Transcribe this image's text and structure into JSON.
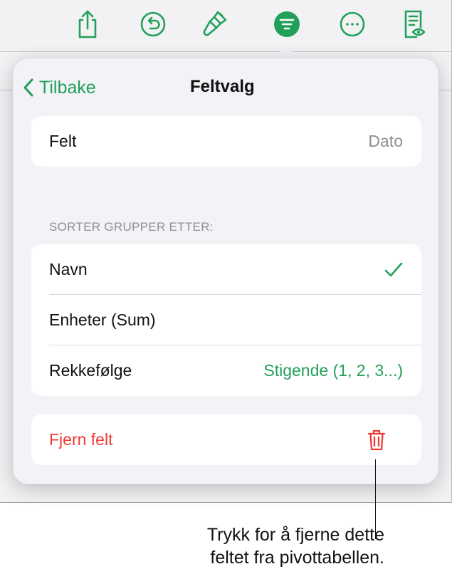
{
  "toolbar": {
    "icons": [
      "share-icon",
      "undo-icon",
      "paintbrush-icon",
      "organize-icon",
      "more-icon",
      "reading-view-icon"
    ],
    "accent": "#22a05a"
  },
  "popover": {
    "back_label": "Tilbake",
    "title": "Feltvalg",
    "field_card": {
      "label": "Felt",
      "value": "Dato"
    },
    "sort_section": {
      "header": "SORTER GRUPPER ETTER:",
      "rows": [
        {
          "label": "Navn",
          "checked": true
        },
        {
          "label": "Enheter (Sum)",
          "checked": false
        },
        {
          "label": "Rekkefølge",
          "value": "Stigende (1, 2, 3...)"
        }
      ]
    },
    "remove": {
      "label": "Fjern felt",
      "icon": "trash-icon",
      "color": "#ef3a35"
    }
  },
  "callout": {
    "line1": "Trykk for å fjerne dette",
    "line2": "feltet fra pivottabellen."
  }
}
